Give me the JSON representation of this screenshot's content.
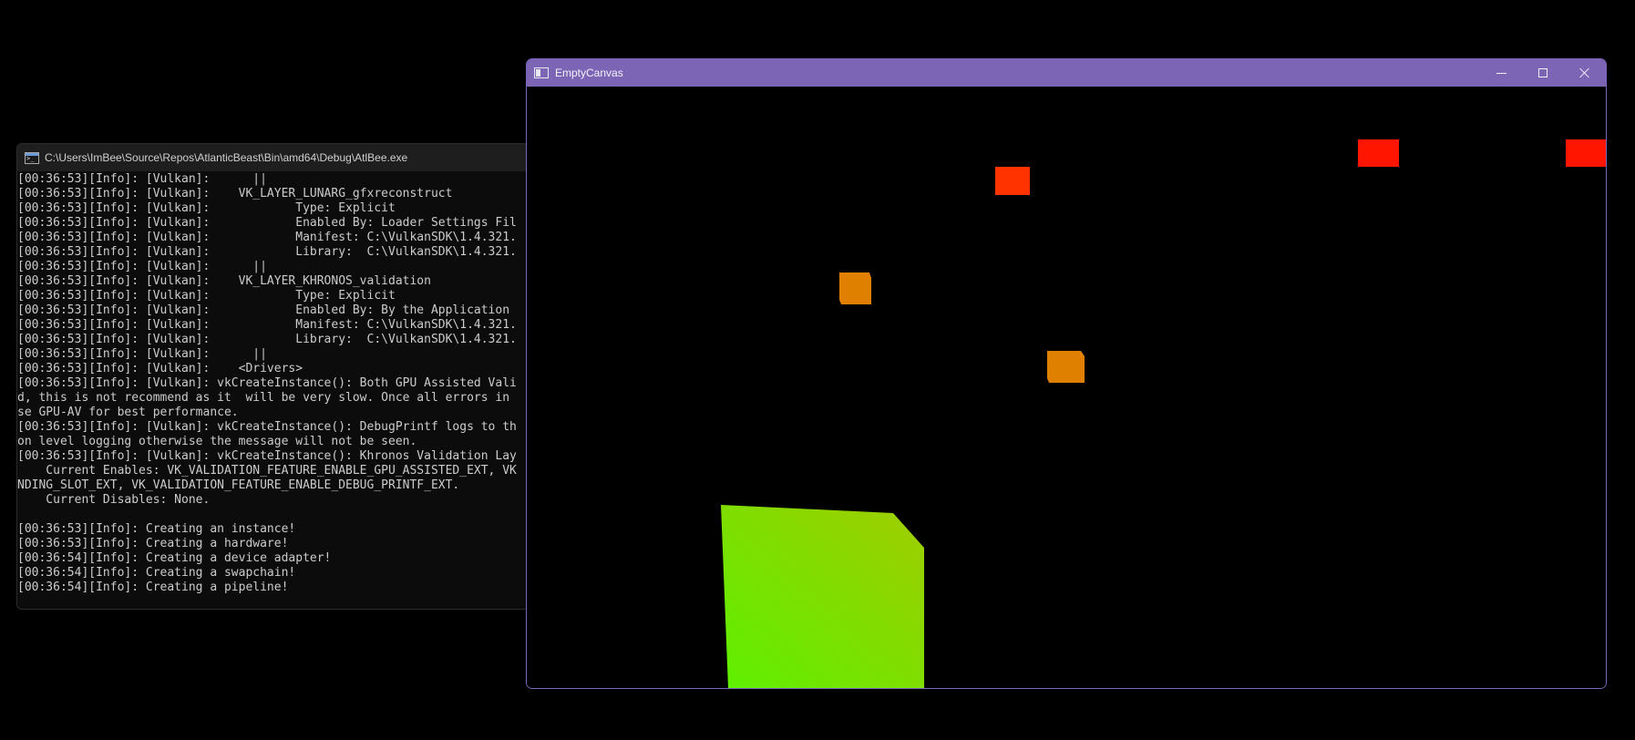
{
  "console": {
    "title": "C:\\Users\\ImBee\\Source\\Repos\\AtlanticBeast\\Bin\\amd64\\Debug\\AtlBee.exe",
    "lines": [
      "[00:36:53][Info]: [Vulkan]:      ||",
      "[00:36:53][Info]: [Vulkan]:    VK_LAYER_LUNARG_gfxreconstruct",
      "[00:36:53][Info]: [Vulkan]:            Type: Explicit",
      "[00:36:53][Info]: [Vulkan]:            Enabled By: Loader Settings Fil",
      "[00:36:53][Info]: [Vulkan]:            Manifest: C:\\VulkanSDK\\1.4.321.",
      "[00:36:53][Info]: [Vulkan]:            Library:  C:\\VulkanSDK\\1.4.321.",
      "[00:36:53][Info]: [Vulkan]:      ||",
      "[00:36:53][Info]: [Vulkan]:    VK_LAYER_KHRONOS_validation",
      "[00:36:53][Info]: [Vulkan]:            Type: Explicit",
      "[00:36:53][Info]: [Vulkan]:            Enabled By: By the Application",
      "[00:36:53][Info]: [Vulkan]:            Manifest: C:\\VulkanSDK\\1.4.321.",
      "[00:36:53][Info]: [Vulkan]:            Library:  C:\\VulkanSDK\\1.4.321.",
      "[00:36:53][Info]: [Vulkan]:      ||",
      "[00:36:53][Info]: [Vulkan]:    <Drivers>",
      "[00:36:53][Info]: [Vulkan]: vkCreateInstance(): Both GPU Assisted Vali",
      "d, this is not recommend as it  will be very slow. Once all errors in",
      "se GPU-AV for best performance.",
      "[00:36:53][Info]: [Vulkan]: vkCreateInstance(): DebugPrintf logs to th",
      "on level logging otherwise the message will not be seen.",
      "[00:36:53][Info]: [Vulkan]: vkCreateInstance(): Khronos Validation Lay",
      "    Current Enables: VK_VALIDATION_FEATURE_ENABLE_GPU_ASSISTED_EXT, VK",
      "NDING_SLOT_EXT, VK_VALIDATION_FEATURE_ENABLE_DEBUG_PRINTF_EXT.",
      "    Current Disables: None.",
      "",
      "[00:36:53][Info]: Creating an instance!",
      "[00:36:53][Info]: Creating a hardware!",
      "[00:36:54][Info]: Creating a device adapter!",
      "[00:36:54][Info]: Creating a swapchain!",
      "[00:36:54][Info]: Creating a pipeline!"
    ]
  },
  "canvas_window": {
    "title": "EmptyCanvas",
    "minimize_icon": "minimize-icon",
    "maximize_icon": "maximize-icon",
    "close_icon": "close-icon"
  },
  "scene": {
    "background": "#000000",
    "cube_colors": {
      "red": "#ff1500",
      "red_orange": "#ff3300",
      "orange": "#e08000",
      "green_light": "#5ef000",
      "green_dark": "#a0cc00"
    }
  },
  "colors": {
    "canvas_titlebar": "#7d65b5",
    "console_background": "#0c0c0c",
    "console_text": "#cccccc"
  }
}
